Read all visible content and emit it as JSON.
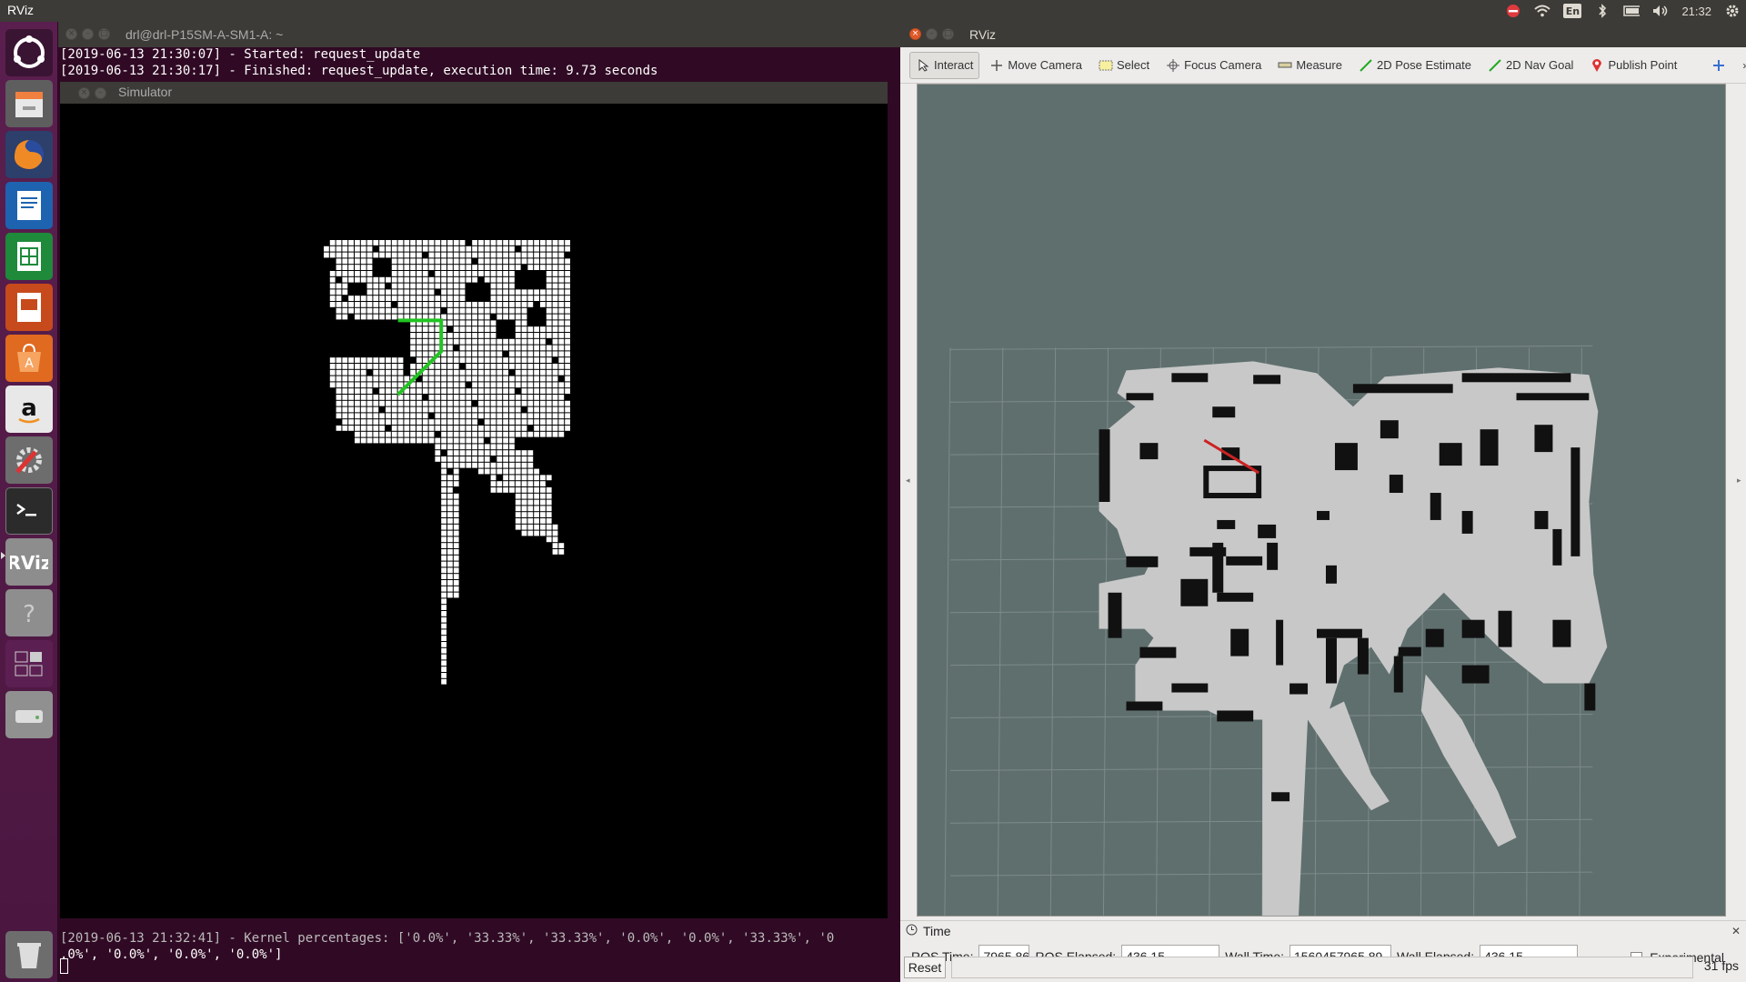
{
  "top_panel": {
    "app_title": "RViz",
    "clock": "21:32",
    "lang": "En",
    "tray_icons": [
      "no-entry-icon",
      "wifi-icon",
      "keyboard-lang-icon",
      "bluetooth-icon",
      "battery-icon",
      "volume-icon",
      "clock",
      "gear-icon"
    ]
  },
  "launcher": {
    "items": [
      "ubuntu-logo-icon",
      "files-icon",
      "firefox-icon",
      "writer-icon",
      "calc-icon",
      "impress-icon",
      "software-center-icon",
      "amazon-icon",
      "system-settings-icon",
      "terminal-icon",
      "rviz-icon",
      "help-icon",
      "workspace-switcher-icon",
      "disk-icon",
      "trash-icon"
    ]
  },
  "terminal": {
    "title": "drl@drl-P15SM-A-SM1-A: ~",
    "lines": [
      "[2019-06-13 21:30:07] - Started: request_update",
      "[2019-06-13 21:30:17] - Finished: request_update, execution time: 9.73 seconds"
    ],
    "bottom_line_1": "[2019-06-13 21:32:41] - Kernel percentages: ['0.0%', '33.33%', '33.33%', '0.0%', '0.0%', '33.33%', '0",
    "bottom_line_2": ".0%', '0.0%', '0.0%', '0.0%']"
  },
  "simulator": {
    "title": "Simulator"
  },
  "rviz": {
    "title": "RViz",
    "tools": [
      {
        "label": "Interact",
        "icon": "cursor-icon"
      },
      {
        "label": "Move Camera",
        "icon": "move-camera-icon"
      },
      {
        "label": "Select",
        "icon": "select-icon"
      },
      {
        "label": "Focus Camera",
        "icon": "focus-camera-icon"
      },
      {
        "label": "Measure",
        "icon": "measure-icon"
      },
      {
        "label": "2D Pose Estimate",
        "icon": "pose-estimate-icon"
      },
      {
        "label": "2D Nav Goal",
        "icon": "nav-goal-icon"
      },
      {
        "label": "Publish Point",
        "icon": "publish-point-icon"
      }
    ],
    "time_panel": {
      "header": "Time",
      "ros_time_label": "ROS Time:",
      "ros_time_value": "7965.86",
      "ros_elapsed_label": "ROS Elapsed:",
      "ros_elapsed_value": "436.15",
      "wall_time_label": "Wall Time:",
      "wall_time_value": "1560457965.89",
      "wall_elapsed_label": "Wall Elapsed:",
      "wall_elapsed_value": "436.15",
      "experimental_label": "Experimental",
      "reset_label": "Reset",
      "fps": "31 fps"
    },
    "colors": {
      "background": "#5f6f6e",
      "free": "#c8c8c8",
      "occupied": "#111111",
      "path": "#cc2222"
    }
  }
}
